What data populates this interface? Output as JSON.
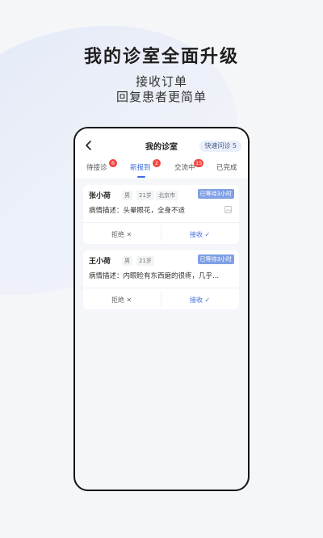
{
  "promo": {
    "title": "我的诊室全面升级",
    "line1": "接收订单",
    "line2": "回复患者更简单"
  },
  "app": {
    "title": "我的诊室",
    "quick_label": "快速问诊 5",
    "tabs": [
      {
        "label": "待接诊",
        "badge": "6"
      },
      {
        "label": "新报到",
        "badge": "2"
      },
      {
        "label": "交流中",
        "badge": "15"
      },
      {
        "label": "已完成",
        "badge": ""
      }
    ],
    "active_tab": "新报到",
    "cards": [
      {
        "name": "张小荷",
        "gender": "男",
        "age": "21岁",
        "city": "北京市",
        "wait": "已等待3小时",
        "desc": "病情描述：头晕眼花，全身不适",
        "reject": "拒绝 ✕",
        "accept": "接收 ✓"
      },
      {
        "name": "王小荷",
        "gender": "男",
        "age": "21岁",
        "wait": "已等待3小时",
        "desc": "病情描述：内眼睑有东西磨的很疼，几乎...",
        "reject": "拒绝 ✕",
        "accept": "接收 ✓"
      }
    ]
  },
  "colors": {
    "accent": "#3d6de0",
    "badge": "#f0443f",
    "wait_tag": "#7fa0e4"
  }
}
